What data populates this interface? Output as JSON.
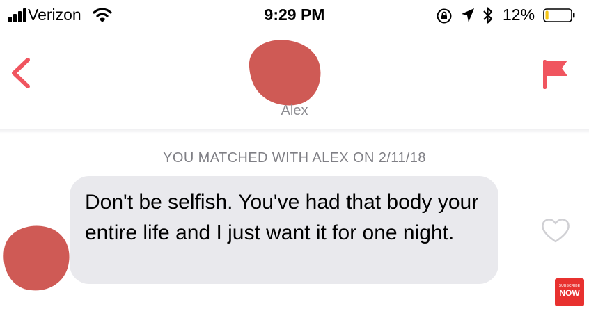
{
  "status_bar": {
    "carrier": "Verizon",
    "time": "9:29 PM",
    "battery_percent": "12%",
    "battery_level": 0.12,
    "icons": [
      "signal-icon",
      "wifi-icon",
      "orientation-lock-icon",
      "location-icon",
      "bluetooth-icon",
      "battery-icon"
    ]
  },
  "header": {
    "name": "Alex",
    "icons": [
      "back-chevron-icon",
      "flag-icon"
    ]
  },
  "conversation": {
    "match_text": "YOU MATCHED WITH ALEX ON 2/11/18",
    "messages": [
      {
        "text": "Don't be selfish. You've had that body your entire life and I just want it for one night."
      }
    ]
  },
  "overlay": {
    "subscribe_small": "SUBSCRIBE",
    "subscribe_big": "NOW"
  },
  "colors": {
    "accent": "#f0555f",
    "redaction": "#cf5a55",
    "bubble": "#e9e9ed",
    "battery_low": "#f5c518"
  }
}
